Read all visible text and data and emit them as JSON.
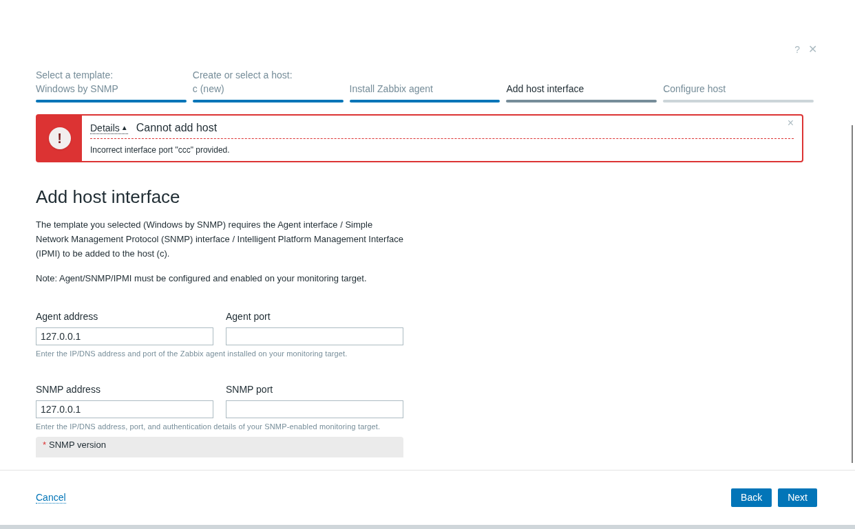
{
  "header": {
    "help": "?",
    "close": "✕"
  },
  "steps": [
    {
      "label": "Select a template:",
      "value": "Windows by SNMP",
      "completed": true,
      "selected": false
    },
    {
      "label": "Create or select a host:",
      "value": "c (new)",
      "completed": true,
      "selected": false
    },
    {
      "value": "Install Zabbix agent",
      "completed": true,
      "selected": false
    },
    {
      "value": "Add host interface",
      "completed": false,
      "selected": true
    },
    {
      "value": "Configure host",
      "completed": false,
      "selected": false
    }
  ],
  "error": {
    "icon": "!",
    "details": "Details",
    "details_expanded": true,
    "details_arrow": "▲",
    "title": "Cannot add host",
    "message": "Incorrect interface port \"ccc\" provided.",
    "close": "×"
  },
  "heading": "Add host interface",
  "description": "The template you selected (Windows by SNMP) requires the Agent interface / Simple Network Management Protocol (SNMP) interface / Intelligent Platform Management Interface (IPMI) to be added to the host (c).",
  "note": "Note: Agent/SNMP/IPMI must be configured and enabled on your monitoring target.",
  "interfaces": [
    {
      "address_label": "Agent address",
      "address": "127.0.0.1",
      "port_label": "Agent port",
      "hint": "Enter the IP/DNS address and port of the Zabbix agent installed on your monitoring target."
    },
    {
      "address_label": "SNMP address",
      "address": "127.0.0.1",
      "port_label": "SNMP port",
      "hint": "Enter the IP/DNS address, port, and authentication details of your SNMP-enabled monitoring target."
    }
  ],
  "snmp_version": {
    "required": "*",
    "label": "SNMP version"
  },
  "footer": {
    "cancel": "Cancel",
    "buttons": [
      "Back",
      "Next"
    ]
  }
}
